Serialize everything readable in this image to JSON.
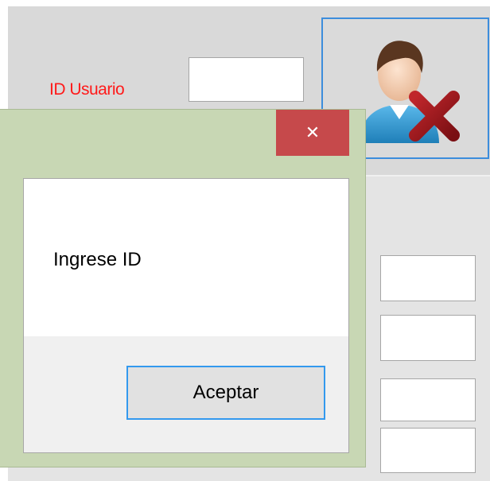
{
  "form": {
    "id_label": "ID Usuario",
    "id_value": "",
    "delete_button_icon": "delete-user-icon",
    "fields": [
      "",
      "",
      "",
      ""
    ]
  },
  "dialog": {
    "close_glyph": "✕",
    "message": "Ingrese ID",
    "ok_label": "Aceptar"
  },
  "colors": {
    "label_red": "#ff1a1a",
    "dialog_frame": "#c8d7b4",
    "close_button": "#c6494b",
    "focus_blue": "#3399ee"
  }
}
